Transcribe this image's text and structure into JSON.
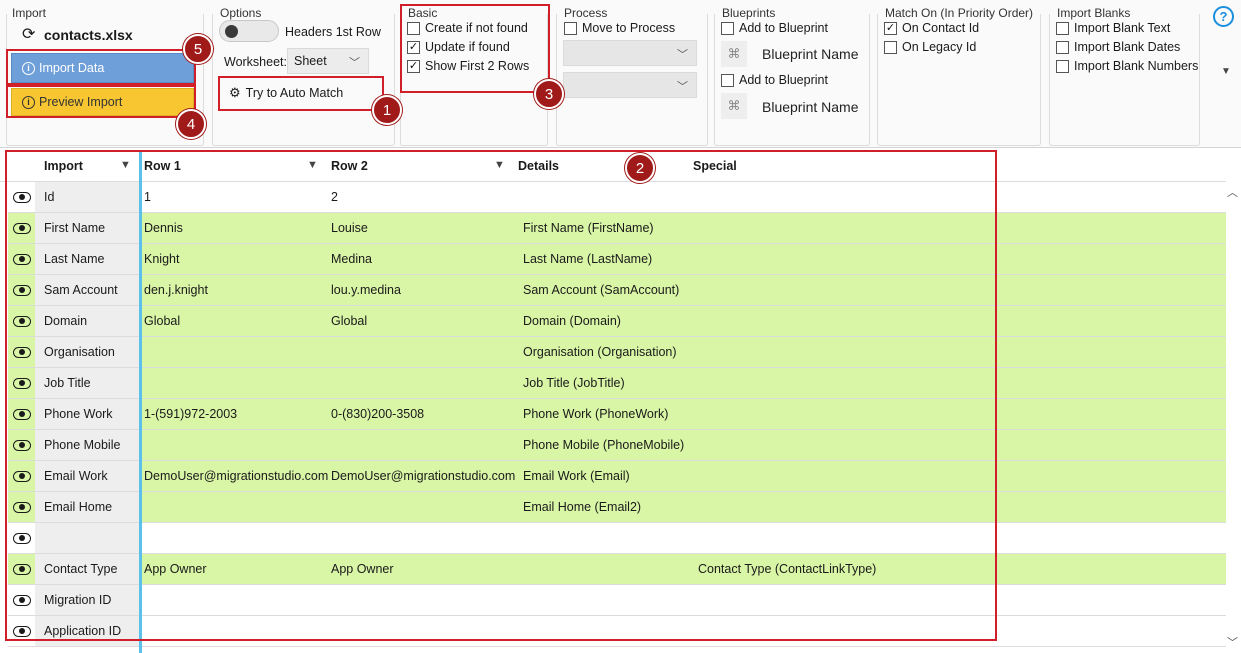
{
  "import": {
    "group_label": "Import",
    "file_name": "contacts.xlsx",
    "import_data_label": "Import Data",
    "preview_import_label": "Preview Import"
  },
  "options": {
    "group_label": "Options",
    "headers_label": "Headers 1st Row",
    "worksheet_label": "Worksheet:",
    "worksheet_value": "Sheet",
    "auto_match_label": "Try to Auto Match"
  },
  "basic": {
    "group_label": "Basic",
    "items": [
      {
        "label": "Create if not found",
        "checked": false
      },
      {
        "label": "Update if found",
        "checked": true
      },
      {
        "label": "Show First 2 Rows",
        "checked": true
      }
    ]
  },
  "process": {
    "group_label": "Process",
    "move_label": "Move to Process"
  },
  "blueprints": {
    "group_label": "Blueprints",
    "add_label_1": "Add to Blueprint",
    "name_1": "Blueprint Name",
    "add_label_2": "Add to Blueprint",
    "name_2": "Blueprint Name"
  },
  "match_on": {
    "group_label": "Match On (In Priority Order)",
    "items": [
      {
        "label": "On Contact Id",
        "checked": true
      },
      {
        "label": "On Legacy Id",
        "checked": false
      }
    ]
  },
  "import_blanks": {
    "group_label": "Import Blanks",
    "items": [
      {
        "label": "Import Blank Text",
        "checked": false
      },
      {
        "label": "Import Blank Dates",
        "checked": false
      },
      {
        "label": "Import Blank Numbers",
        "checked": false
      }
    ]
  },
  "help_glyph": "?",
  "grid": {
    "columns": [
      "Import",
      "Row 1",
      "Row 2",
      "Details",
      "Special"
    ],
    "rows": [
      {
        "name": "Id",
        "row1": "1",
        "row2": "2",
        "details": "",
        "special": "",
        "mapped": false
      },
      {
        "name": "First Name",
        "row1": "Dennis",
        "row2": "Louise",
        "details": "First Name (FirstName)",
        "special": "",
        "mapped": true
      },
      {
        "name": "Last Name",
        "row1": "Knight",
        "row2": "Medina",
        "details": "Last Name (LastName)",
        "special": "",
        "mapped": true
      },
      {
        "name": "Sam Account",
        "row1": "den.j.knight",
        "row2": "lou.y.medina",
        "details": "Sam Account (SamAccount)",
        "special": "",
        "mapped": true
      },
      {
        "name": "Domain",
        "row1": "Global",
        "row2": "Global",
        "details": "Domain (Domain)",
        "special": "",
        "mapped": true
      },
      {
        "name": "Organisation",
        "row1": "",
        "row2": "",
        "details": "Organisation (Organisation)",
        "special": "",
        "mapped": true
      },
      {
        "name": "Job Title",
        "row1": "",
        "row2": "",
        "details": "Job Title (JobTitle)",
        "special": "",
        "mapped": true
      },
      {
        "name": "Phone Work",
        "row1": "1-(591)972-2003",
        "row2": "0-(830)200-3508",
        "details": "Phone Work (PhoneWork)",
        "special": "",
        "mapped": true
      },
      {
        "name": "Phone Mobile",
        "row1": "",
        "row2": "",
        "details": "Phone Mobile (PhoneMobile)",
        "special": "",
        "mapped": true
      },
      {
        "name": "Email Work",
        "row1": "DemoUser@migrationstudio.com",
        "row2": "DemoUser@migrationstudio.com",
        "details": "Email Work (Email)",
        "special": "",
        "mapped": true
      },
      {
        "name": "Email Home",
        "row1": "",
        "row2": "",
        "details": "Email Home (Email2)",
        "special": "",
        "mapped": true
      },
      {
        "name": "",
        "row1": "",
        "row2": "",
        "details": "",
        "special": "",
        "mapped": false
      },
      {
        "name": "Contact Type",
        "row1": "App Owner",
        "row2": "App Owner",
        "details": "",
        "special": "Contact Type (ContactLinkType)",
        "mapped": true
      },
      {
        "name": "Migration ID",
        "row1": "",
        "row2": "",
        "details": "",
        "special": "",
        "mapped": false
      },
      {
        "name": "Application ID",
        "row1": "",
        "row2": "",
        "details": "",
        "special": "",
        "mapped": false
      }
    ]
  },
  "callouts": [
    "1",
    "2",
    "3",
    "4",
    "5"
  ],
  "colors": {
    "import_button": "#6f9fd8",
    "preview_button": "#f7c631",
    "mapped_row": "#d9f5a6",
    "highlight": "#d11f2a",
    "badge": "#a01a1a",
    "divider": "#5bc0ea"
  }
}
